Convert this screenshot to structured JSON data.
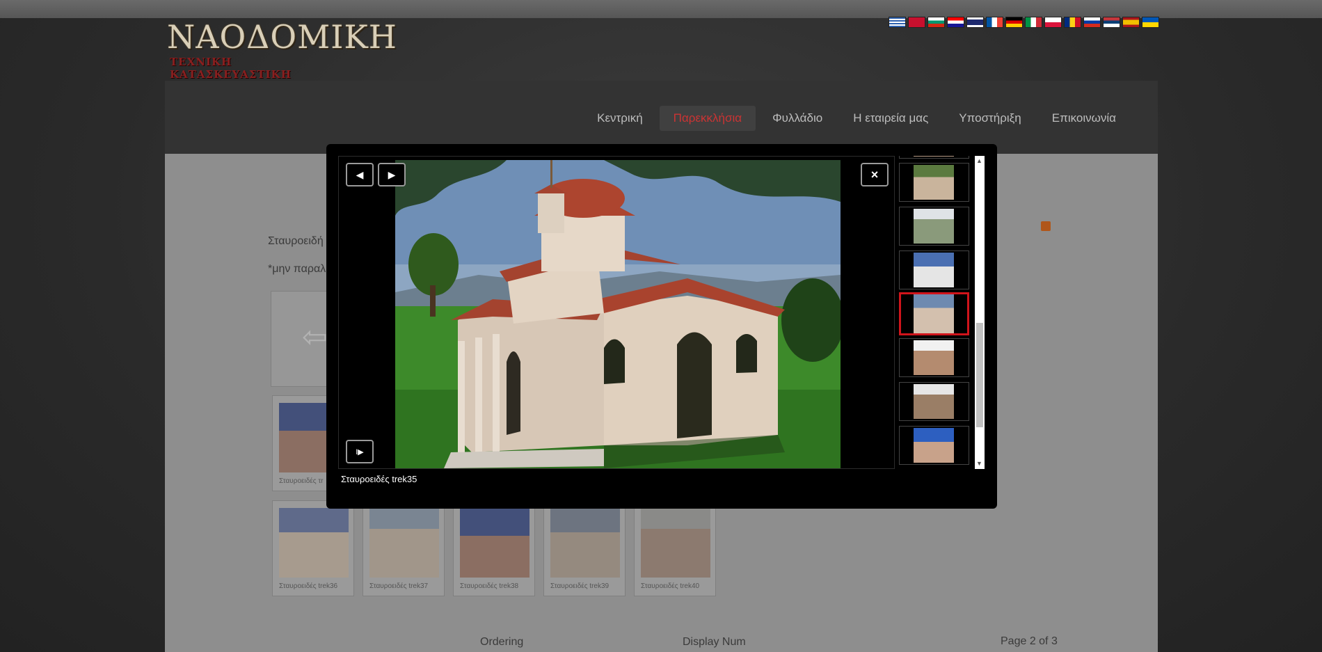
{
  "header": {
    "logo_line1": "ΝΑΟΔΟΜΙΚΗ",
    "logo_line2": "ΤΕΧΝΙΚΗ ΚΑΤΑΣΚΕΥΑΣΤΙΚΗ",
    "flags": [
      "greek",
      "albanian",
      "bulgarian",
      "croatian",
      "english",
      "french",
      "german",
      "italian",
      "polish",
      "romanian",
      "russian",
      "serbian",
      "spanish",
      "ukrainian"
    ]
  },
  "nav": {
    "items": [
      "Κεντρική",
      "Παρεκκλήσια",
      "Φυλλάδιο",
      "Η εταιρεία μας",
      "Υποστήριξη",
      "Επικοινωνία"
    ],
    "active_index": 1
  },
  "content": {
    "text1": "Σταυροειδή",
    "text2": "*μην παραλ",
    "first_card_caption": "Σταυροειδές τr",
    "cards": [
      {
        "caption": "Σταυροειδές trek36"
      },
      {
        "caption": "Σταυροειδές trek37"
      },
      {
        "caption": "Σταυροειδές trek38"
      },
      {
        "caption": "Σταυροειδές trek39"
      },
      {
        "caption": "Σταυροειδές trek40"
      }
    ],
    "footer": {
      "ordering": "Ordering",
      "display_num": "Display Num",
      "page": "Page 2 of 3"
    }
  },
  "lightbox": {
    "caption": "Σταυροειδές trek35",
    "prev_icon": "◀",
    "next_icon": "▶",
    "close_icon": "×",
    "play_icon": "I▶",
    "selected_thumb_index": 3
  },
  "colors": {
    "accent": "#cc3333",
    "selection": "#d0141b"
  }
}
